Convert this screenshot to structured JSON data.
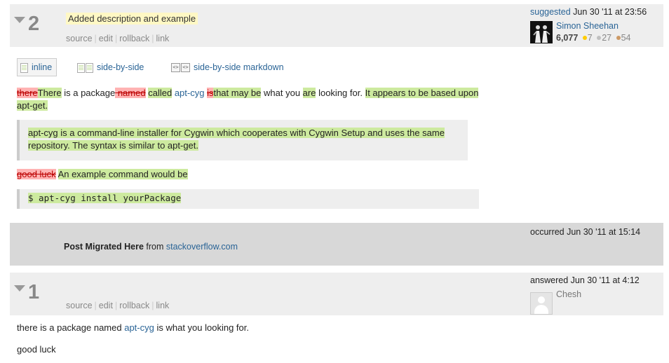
{
  "rev2": {
    "number": "2",
    "comment": "Added description and example",
    "links": [
      "source",
      "edit",
      "rollback",
      "link"
    ],
    "action": "suggested",
    "date": "Jun 30 '11 at 23:56",
    "user": "Simon Sheehan",
    "rep": "6,077",
    "gold": "7",
    "silver": "27",
    "bronze": "54"
  },
  "tabs": [
    "inline",
    "side-by-side",
    "side-by-side markdown"
  ],
  "diff": {
    "p1": [
      {
        "t": "del",
        "v": "there"
      },
      {
        "t": "ins",
        "v": "There"
      },
      {
        "t": "txt",
        "v": " is a package"
      },
      {
        "t": "del",
        "v": " named"
      },
      {
        "t": "txt",
        "v": " "
      },
      {
        "t": "ins",
        "v": "called"
      },
      {
        "t": "txt",
        "v": " "
      },
      {
        "t": "link",
        "v": "apt-cyg"
      },
      {
        "t": "txt",
        "v": " "
      },
      {
        "t": "del",
        "v": "is"
      },
      {
        "t": "ins",
        "v": "that may be"
      },
      {
        "t": "txt",
        "v": " what you "
      },
      {
        "t": "ins",
        "v": "are"
      },
      {
        "t": "txt",
        "v": " looking for. "
      },
      {
        "t": "ins",
        "v": "It appears to be based upon apt-get."
      }
    ],
    "quote": "apt-cyg is a command-line installer for Cygwin which cooperates with Cygwin Setup and uses the same repository. The syntax is similar to apt-get.",
    "p2": [
      {
        "t": "del",
        "v": "good luck"
      },
      {
        "t": "txt",
        "v": " "
      },
      {
        "t": "ins",
        "v": "An example command would be"
      }
    ],
    "code": "$ apt-cyg install yourPackage"
  },
  "migration": {
    "occurred": "occurred Jun 30 '11 at 15:14",
    "bold": "Post Migrated Here",
    "from": " from ",
    "site": "stackoverflow.com"
  },
  "rev1": {
    "number": "1",
    "links": [
      "source",
      "edit",
      "rollback",
      "link"
    ],
    "action": "answered Jun 30 '11 at 4:12",
    "user": "Chesh",
    "line1_pre": "there is a package named ",
    "line1_link": "apt-cyg",
    "line1_post": " is what you looking for.",
    "line2": "good luck"
  }
}
